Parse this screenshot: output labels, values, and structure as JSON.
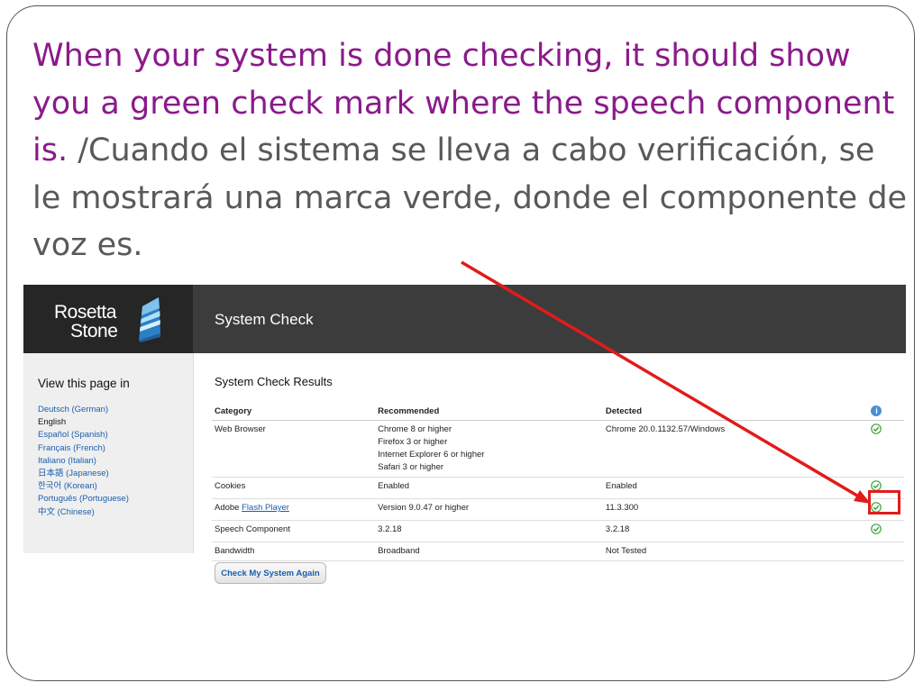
{
  "caption": {
    "english": "When your system is done checking, it should show you a green check mark where the speech component is.",
    "spanish": "/Cuando el sistema se lleva a cabo verificación, se le mostrará una marca verde, donde el componente de voz es."
  },
  "colors": {
    "caption_english": "#8b1a8b",
    "caption_spanish": "#595959",
    "check_green": "#3aa53a",
    "annotation_red": "#e21b1b",
    "header_dark": "#3c3c3c"
  },
  "app": {
    "logo": {
      "line1": "Rosetta",
      "line2": "Stone",
      "icon": "rosetta-stone-logo-icon"
    },
    "header_title": "System Check"
  },
  "sidebar": {
    "heading": "View this page in",
    "languages": [
      {
        "label": "Deutsch (German)",
        "current": false
      },
      {
        "label": "English",
        "current": true
      },
      {
        "label": "Español (Spanish)",
        "current": false
      },
      {
        "label": "Français (French)",
        "current": false
      },
      {
        "label": "Italiano (Italian)",
        "current": false
      },
      {
        "label": "日本語 (Japanese)",
        "current": false
      },
      {
        "label": "한국어 (Korean)",
        "current": false
      },
      {
        "label": "Português (Portuguese)",
        "current": false
      },
      {
        "label": "中文 (Chinese)",
        "current": false
      }
    ]
  },
  "results": {
    "title": "System Check Results",
    "columns": [
      "Category",
      "Recommended",
      "Detected"
    ],
    "status_header_icon": "info-icon",
    "rows": [
      {
        "category": "Web Browser",
        "recommended": [
          "Chrome 8 or higher",
          "Firefox 3 or higher",
          "Internet Explorer 6 or higher",
          "Safari 3 or higher"
        ],
        "detected": "Chrome 20.0.1132.57/Windows",
        "status_icon": "green-check-icon"
      },
      {
        "category": "Cookies",
        "recommended": [
          "Enabled"
        ],
        "detected": "Enabled",
        "status_icon": "green-check-icon"
      },
      {
        "category_prefix": "Adobe ",
        "category_link": "Flash Player",
        "recommended": [
          "Version 9.0.47 or higher"
        ],
        "detected": "11.3.300",
        "status_icon": "green-check-icon"
      },
      {
        "category": "Speech Component",
        "recommended": [
          "3.2.18"
        ],
        "detected": "3.2.18",
        "status_icon": "green-check-icon"
      },
      {
        "category": "Bandwidth",
        "recommended": [
          "Broadband"
        ],
        "detected": "Not Tested",
        "status_icon": ""
      }
    ]
  },
  "button": {
    "label": "Check My System Again"
  }
}
